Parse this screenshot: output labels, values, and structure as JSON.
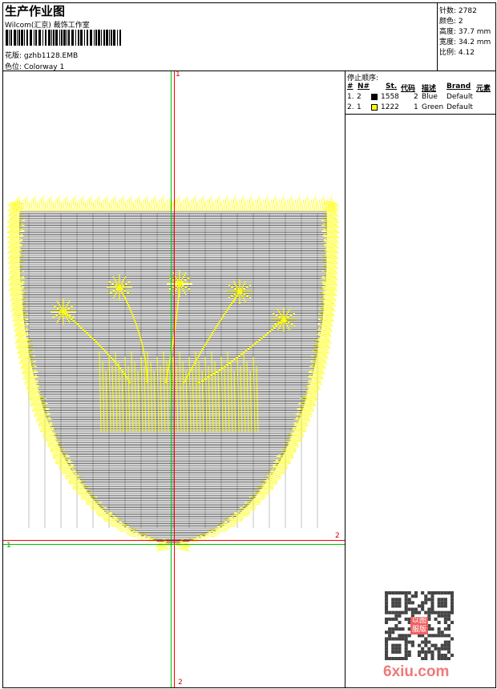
{
  "header": {
    "title": "生产作业图",
    "company": "Wilcom(汇京) 裁饰工作室",
    "design_label": "花版:",
    "design_value": "gzhb1128.EMB",
    "colorway_label": "色位:",
    "colorway_value": "Colorway 1"
  },
  "info": {
    "stitches": "针数: 2782",
    "colors": "颜色: 2",
    "height": "高度: 37.7 mm",
    "width": "宽度: 34.2 mm",
    "scale": "比例: 4.12"
  },
  "stop_sequence": {
    "title": "停止顺序:",
    "columns": [
      "#",
      "N#",
      "St.",
      "代码",
      "描述",
      "Brand",
      "元素"
    ],
    "rows": [
      {
        "idx": "1.",
        "n": "2",
        "swatch": "#000000",
        "st": "1558",
        "code": "2",
        "desc": "Blue",
        "brand": "Default"
      },
      {
        "idx": "2.",
        "n": "1",
        "swatch": "#ffff00",
        "st": "1222",
        "code": "1",
        "desc": "Green",
        "brand": "Default"
      }
    ]
  },
  "guides": {
    "top_label": "1",
    "bottom_label": "2",
    "right_label": "2",
    "left_label": "1"
  },
  "colors": {
    "stitch_black": "#000000",
    "stitch_yellow": "#ffff00",
    "guide_red": "#ff0000",
    "guide_green": "#00c000"
  },
  "watermark": {
    "text": "6xiu.com",
    "seal": "以图服版"
  }
}
